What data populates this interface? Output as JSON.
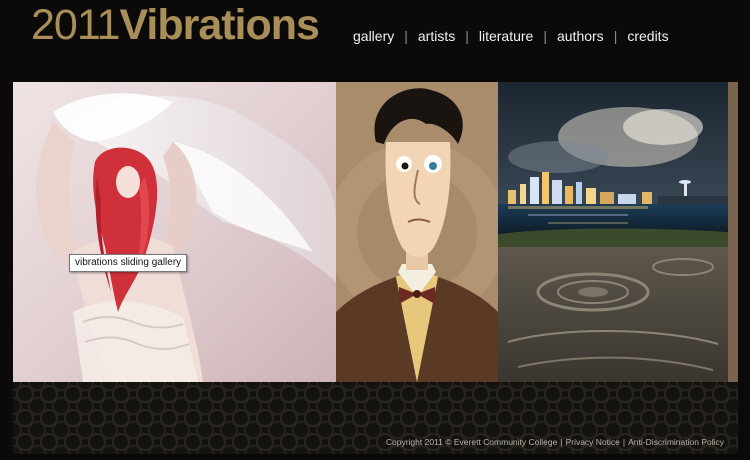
{
  "logo": {
    "year": "2011",
    "name": "Vibrations"
  },
  "nav": [
    {
      "label": "gallery"
    },
    {
      "label": "artists"
    },
    {
      "label": "literature"
    },
    {
      "label": "authors"
    },
    {
      "label": "credits"
    }
  ],
  "nav_separator": "|",
  "gallery": {
    "tooltip": "vibrations sliding gallery",
    "slides": [
      {
        "subject": "red-haired woman with white fabric"
      },
      {
        "subject": "illustrated man in bow tie"
      },
      {
        "subject": "night city skyline over water"
      },
      {
        "subject": "partial next image"
      }
    ]
  },
  "footer": {
    "copyright": "Copyright 2011 © Everett Community College",
    "privacy": "Privacy Notice",
    "policy": "Anti-Discrimination Policy",
    "separator": "|"
  },
  "colors": {
    "background": "#0b0a08",
    "brand_gold": "#a88e58",
    "nav_text": "#f2f2f2"
  }
}
